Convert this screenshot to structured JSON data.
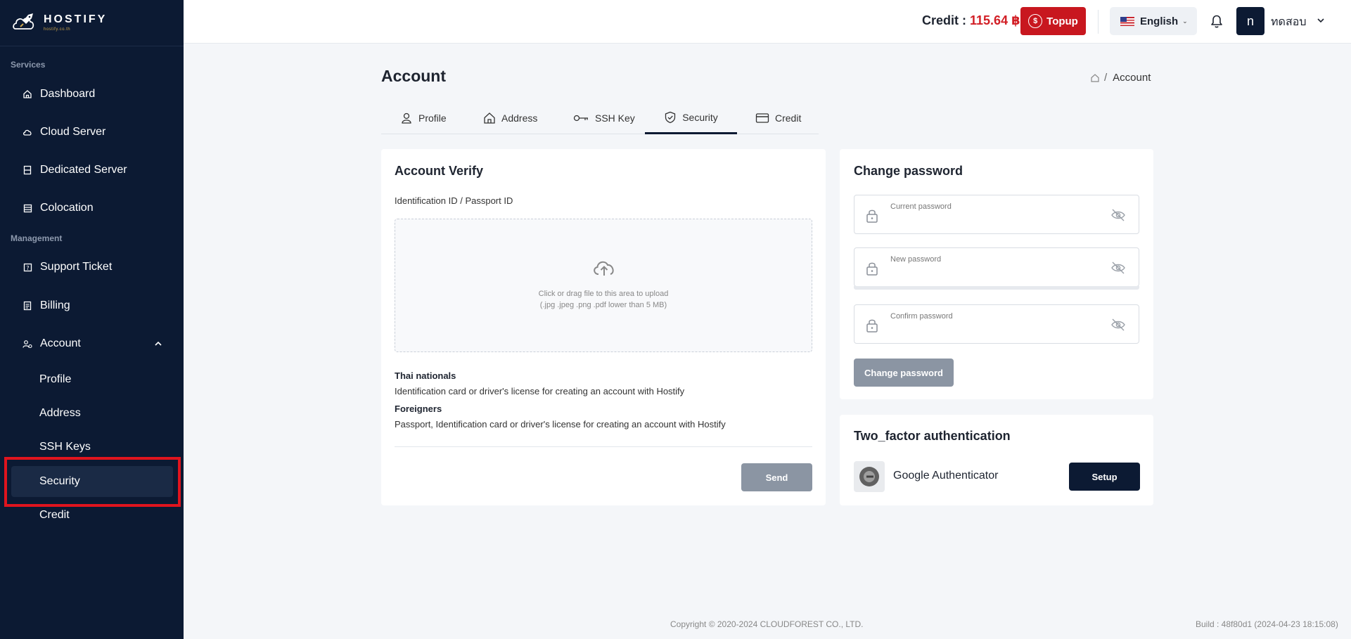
{
  "sidebar": {
    "logo": {
      "brand": "HOSTIFY",
      "sub": "hostify.co.th"
    },
    "sections": {
      "services": "Services",
      "management": "Management"
    },
    "items": [
      {
        "label": "Dashboard",
        "icon": "home-icon"
      },
      {
        "label": "Cloud Server",
        "icon": "cloud-icon"
      },
      {
        "label": "Dedicated Server",
        "icon": "server-icon"
      },
      {
        "label": "Colocation",
        "icon": "rack-icon"
      },
      {
        "label": "Support Ticket",
        "icon": "ticket-icon"
      },
      {
        "label": "Billing",
        "icon": "invoice-icon"
      },
      {
        "label": "Account",
        "icon": "user-group-icon"
      }
    ],
    "account_sub": [
      {
        "label": "Profile"
      },
      {
        "label": "Address"
      },
      {
        "label": "SSH Keys"
      },
      {
        "label": "Security",
        "active": true
      },
      {
        "label": "Credit"
      }
    ],
    "bg_color": "#0c1a33",
    "highlight_color": "#e0141e"
  },
  "topbar": {
    "credit_label": "Credit : ",
    "credit_amount": "115.64 ฿",
    "topup": "Topup",
    "language": "English",
    "avatar_initial": "n",
    "username": "ทดสอบ"
  },
  "page": {
    "title": "Account",
    "breadcrumb": "Account"
  },
  "tabs": [
    {
      "label": "Profile",
      "icon": "user-icon"
    },
    {
      "label": "Address",
      "icon": "home-icon"
    },
    {
      "label": "SSH Key",
      "icon": "key-icon"
    },
    {
      "label": "Security",
      "icon": "shield-icon",
      "active": true
    },
    {
      "label": "Credit",
      "icon": "credit-card-icon"
    }
  ],
  "verify": {
    "title": "Account Verify",
    "id_label": "Identification ID / Passport ID",
    "upload_hint": "Click or drag file to this area to upload",
    "upload_types": "(.jpg .jpeg .png .pdf lower than 5 MB)",
    "thai_heading": "Thai nationals",
    "thai_text": "Identification card or driver's license for creating an account with Hostify",
    "foreign_heading": "Foreigners",
    "foreign_text": "Passport, Identification card or driver's license for creating an account with Hostify",
    "send": "Send"
  },
  "password": {
    "title": "Change password",
    "current": "Current password",
    "new": "New password",
    "confirm": "Confirm password",
    "button": "Change password"
  },
  "twofa": {
    "title": "Two_factor authentication",
    "app": "Google Authenticator",
    "setup": "Setup"
  },
  "footer": {
    "copyright": "Copyright © 2020-2024 CLOUDFOREST CO., LTD.",
    "build": "Build : 48f80d1 (2024-04-23 18:15:08)"
  },
  "colors": {
    "accent": "#c8171f",
    "navy": "#0c1a33",
    "disabled": "#8b95a3"
  }
}
